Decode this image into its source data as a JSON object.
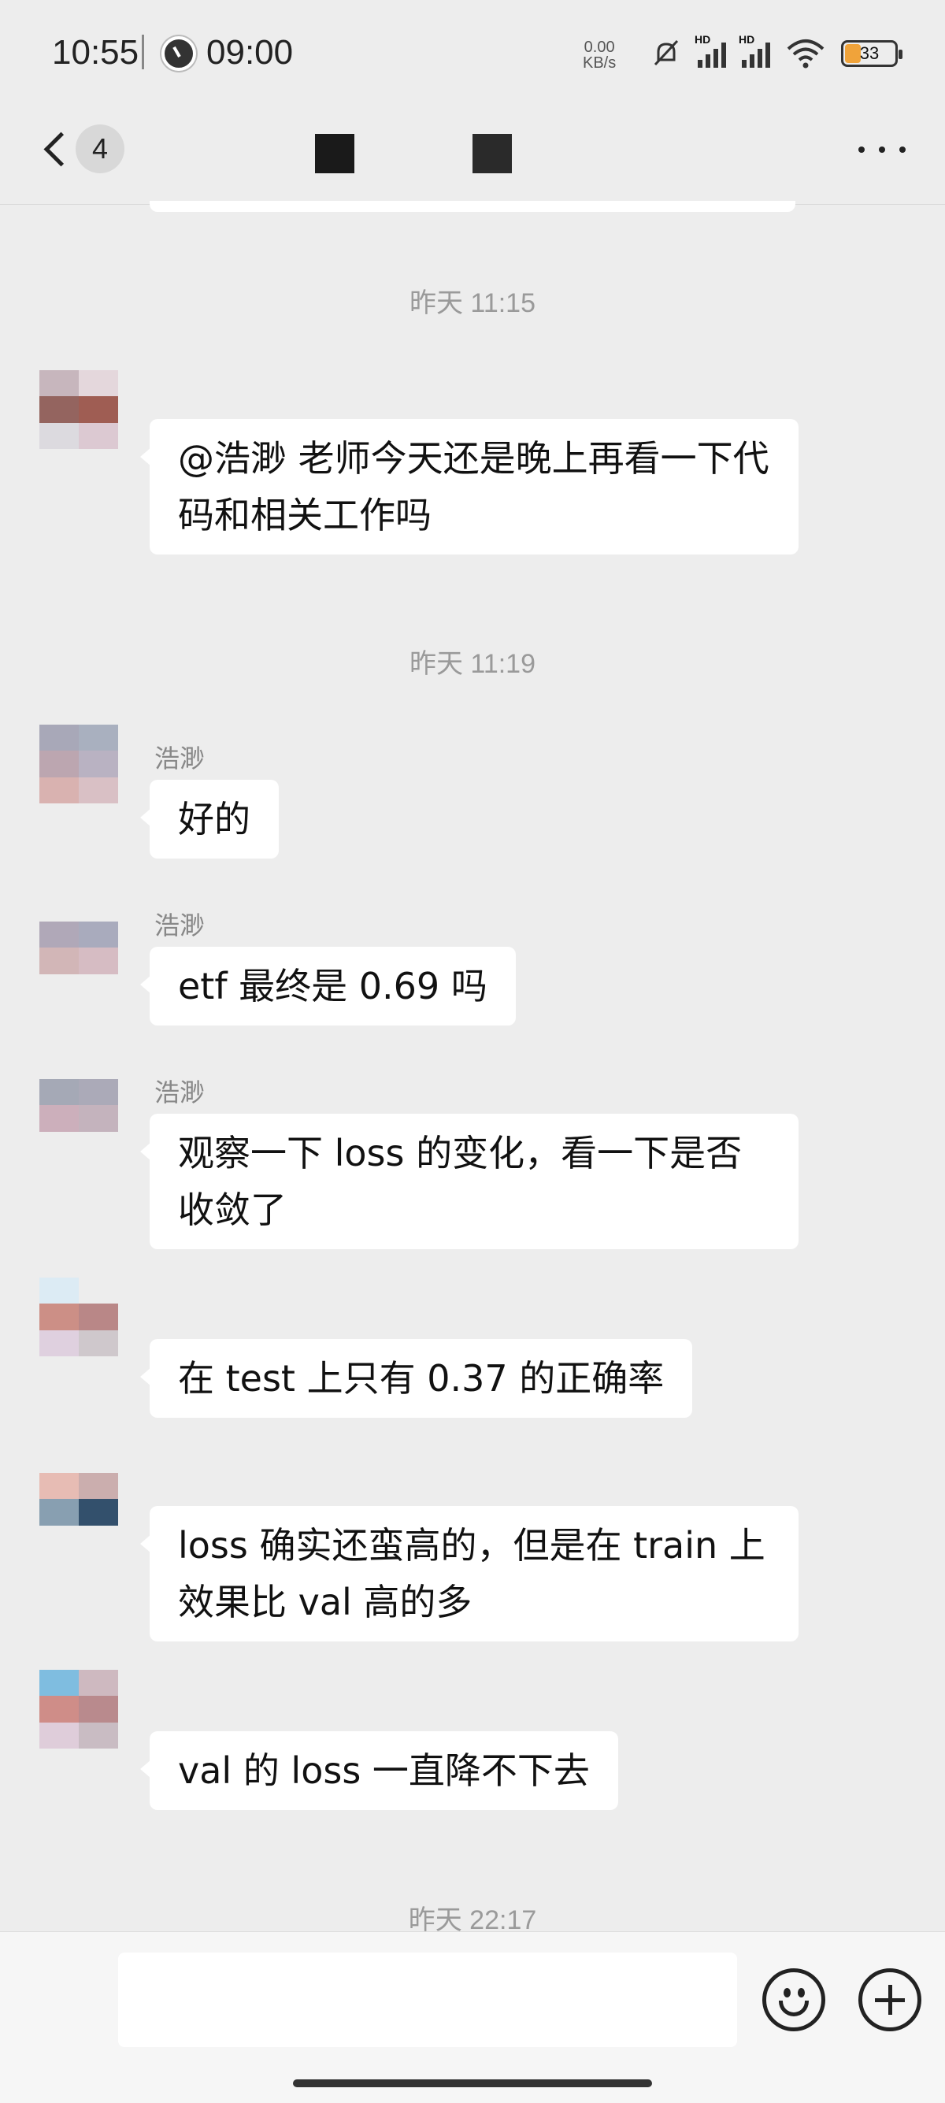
{
  "status_bar": {
    "time": "10:55",
    "alarm_time": "09:00",
    "net_speed_value": "0.00",
    "net_speed_unit": "KB/s",
    "signal1_label": "HD",
    "signal2_label": "HD",
    "battery": "33",
    "icons": [
      "clock-app-icon",
      "mute-bell-icon",
      "signal-icon",
      "signal-icon",
      "wifi-icon",
      "battery-icon"
    ]
  },
  "header": {
    "unread_count": "4",
    "icons": [
      "back-arrow-icon",
      "more-dots-icon"
    ]
  },
  "messages": {
    "ts1": "昨天 11:15",
    "m1_text": "@浩渺 老师今天还是晚上再看一下代码和相关工作吗",
    "ts2": "昨天 11:19",
    "m2_sender": "浩渺",
    "m2_text": "好的",
    "m3_sender": "浩渺",
    "m3_text": "etf 最终是 0.69 吗",
    "m4_sender": "浩渺",
    "m4_text": "观察一下 loss 的变化，看一下是否收敛了",
    "m5_text": "在 test 上只有 0.37 的正确率",
    "m6_text": "loss 确实还蛮高的，但是在 train 上效果比 val 高的多",
    "m7_text": "val 的 loss 一直降不下去",
    "ts3": "昨天 22:17"
  },
  "input_bar": {
    "icons": [
      "emoji-icon",
      "plus-icon"
    ]
  },
  "colors": {
    "background": "#ededed",
    "bubble": "#ffffff",
    "timestamp": "#9a9a9a",
    "battery_fill": "#f0a33a"
  }
}
